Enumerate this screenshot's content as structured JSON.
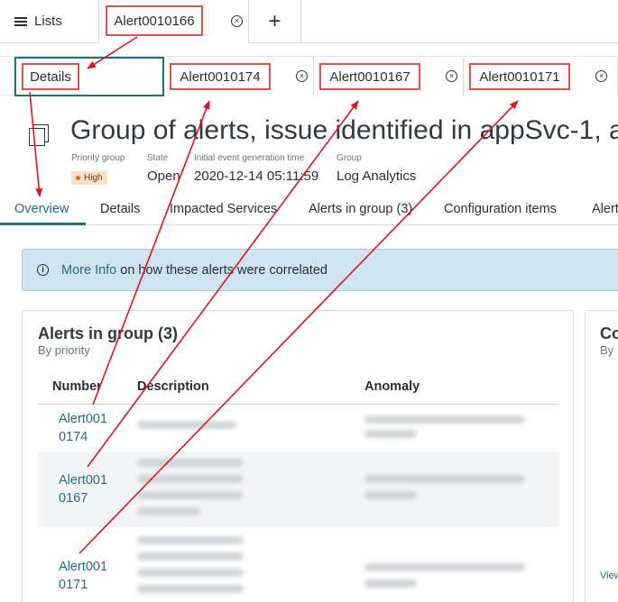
{
  "tabs": {
    "lists_label": "Lists",
    "alert_tab_label": "Alert0010166",
    "close_glyph": "⊗",
    "add_glyph": "+"
  },
  "subtabs": [
    "Details",
    "Alert0010174",
    "Alert0010167",
    "Alert0010171"
  ],
  "header": {
    "title": "Group of alerts, issue identified in appSvc-1, a",
    "meta": [
      {
        "label": "Priority group",
        "value": "High"
      },
      {
        "label": "State",
        "value": "Open"
      },
      {
        "label": "Initial event generation time",
        "value": "2020-12-14 05:11:59"
      },
      {
        "label": "Group",
        "value": "Log Analytics"
      }
    ]
  },
  "view_tabs": [
    "Overview",
    "Details",
    "Impacted Services",
    "Alerts in group (3)",
    "Configuration items",
    "Alert"
  ],
  "active_view_tab": "Overview",
  "banner": {
    "link": "More Info",
    "text": "on how these alerts were correlated"
  },
  "alerts_card": {
    "title": "Alerts in group (3)",
    "subtitle": "By priority",
    "columns": [
      "Number",
      "Description",
      "Anomaly"
    ],
    "rows": [
      {
        "number_line1": "Alert001",
        "number_line2": "0174"
      },
      {
        "number_line1": "Alert001",
        "number_line2": "0167"
      },
      {
        "number_line1": "Alert001",
        "number_line2": "0171"
      }
    ]
  },
  "side_card": {
    "title": "Co",
    "subtitle": "By",
    "link": "View"
  },
  "colors": {
    "accent": "#1f6f7c",
    "annotation": "#e0524a",
    "arrow": "#e0141e",
    "banner_bg": "#cfe3f1",
    "badge_bg": "#f6e2c4"
  }
}
